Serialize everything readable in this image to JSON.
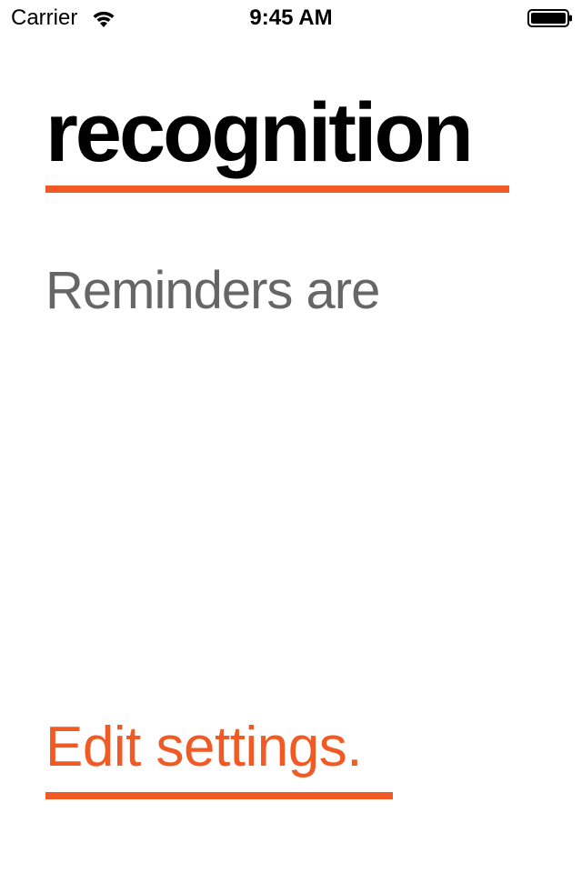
{
  "status_bar": {
    "carrier": "Carrier",
    "time": "9:45 AM",
    "wifi_icon": "wifi-icon",
    "battery_icon": "battery-icon"
  },
  "main": {
    "title": "recognition",
    "subtitle": "Reminders are",
    "edit_link": "Edit settings."
  },
  "colors": {
    "accent": "#f15a24",
    "title": "#000000",
    "subtitle": "#666666",
    "background": "#ffffff"
  }
}
